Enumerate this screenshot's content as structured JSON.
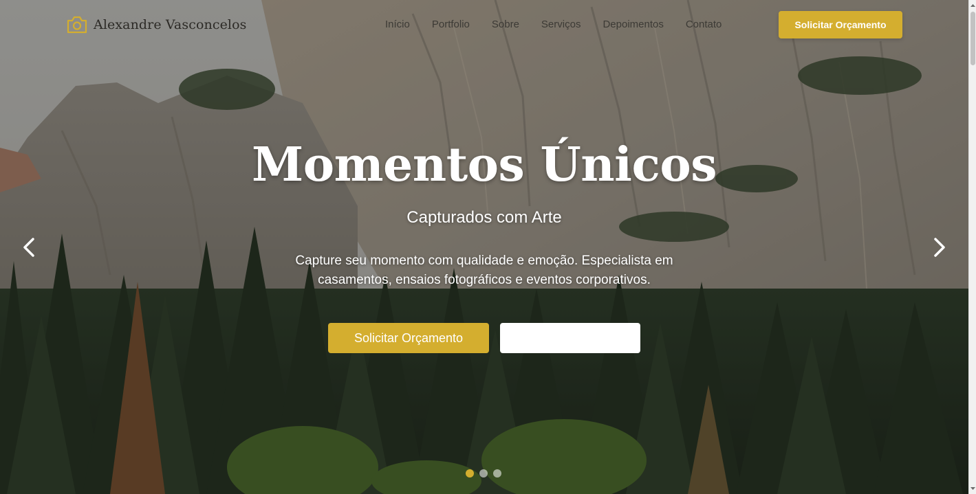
{
  "header": {
    "brand_name": "Alexandre Vasconcelos",
    "brand_icon": "camera-icon",
    "nav": [
      "Início",
      "Portfolio",
      "Sobre",
      "Serviços",
      "Depoimentos",
      "Contato"
    ],
    "cta_label": "Solicitar Orçamento"
  },
  "hero": {
    "title": "Momentos Únicos",
    "subtitle": "Capturados com Arte",
    "description": "Capture seu momento com qualidade e emoção. Especialista em casamentos, ensaios fotográficos e eventos corporativos.",
    "primary_button": "Solicitar Orçamento",
    "secondary_button": "",
    "prev_icon": "chevron-left-icon",
    "next_icon": "chevron-right-icon",
    "slides_total": 3,
    "active_slide": 1
  },
  "colors": {
    "accent": "#d4ae2f",
    "text_light": "#ffffff",
    "nav_text": "#3c3a35"
  }
}
